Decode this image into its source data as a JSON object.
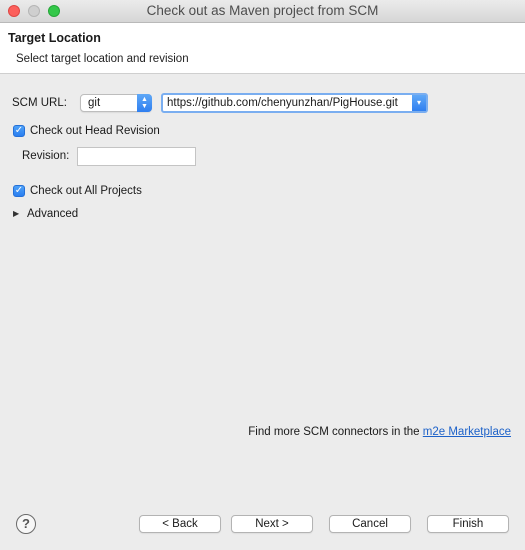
{
  "window": {
    "title": "Check out as Maven project from SCM"
  },
  "header": {
    "title": "Target Location",
    "description": "Select target location and revision"
  },
  "scm": {
    "label": "SCM URL:",
    "type_value": "git",
    "url_value": "https://github.com/chenyunzhan/PigHouse.git"
  },
  "head_revision": {
    "checked": true,
    "label": "Check out Head Revision"
  },
  "revision": {
    "label": "Revision:",
    "value": ""
  },
  "all_projects": {
    "checked": true,
    "label": "Check out All Projects"
  },
  "advanced": {
    "label": "Advanced"
  },
  "marketplace": {
    "text": "Find more SCM connectors in the ",
    "link": "m2e Marketplace"
  },
  "buttons": {
    "back": "< Back",
    "next": "Next >",
    "cancel": "Cancel",
    "finish": "Finish"
  },
  "icons": {
    "help": "?",
    "check": "✓",
    "disclosure": "▶",
    "dropdown": "▾"
  },
  "colors": {
    "accent": "#2f7ff0",
    "link": "#1d62c9"
  }
}
